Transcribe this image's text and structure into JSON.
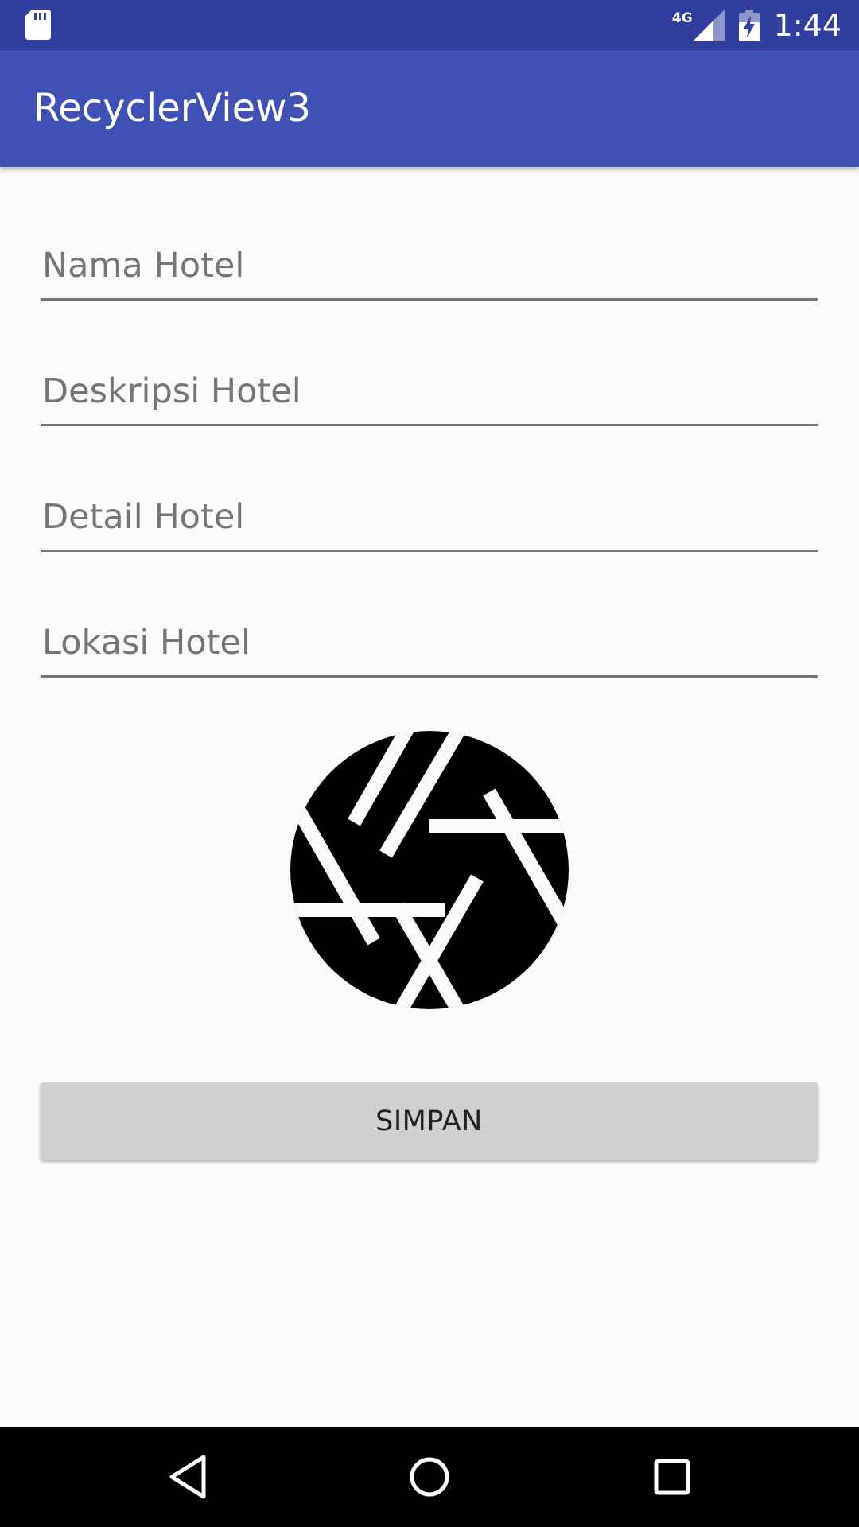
{
  "status_bar": {
    "network_type": "4G",
    "time": "1:44",
    "background_color": "#303f9f",
    "icons": [
      "sd-card-icon",
      "signal-icon",
      "battery-charging-icon"
    ]
  },
  "app_bar": {
    "title": "RecyclerView3",
    "background_color": "#3f51b5"
  },
  "form": {
    "fields": [
      {
        "placeholder": "Nama Hotel",
        "value": ""
      },
      {
        "placeholder": "Deskripsi Hotel",
        "value": ""
      },
      {
        "placeholder": "Detail Hotel",
        "value": ""
      },
      {
        "placeholder": "Lokasi Hotel",
        "value": ""
      }
    ],
    "image_picker_icon": "camera-aperture-icon",
    "save_label": "SIMPAN"
  },
  "nav_bar": {
    "icons": [
      "back-icon",
      "home-icon",
      "recents-icon"
    ]
  }
}
